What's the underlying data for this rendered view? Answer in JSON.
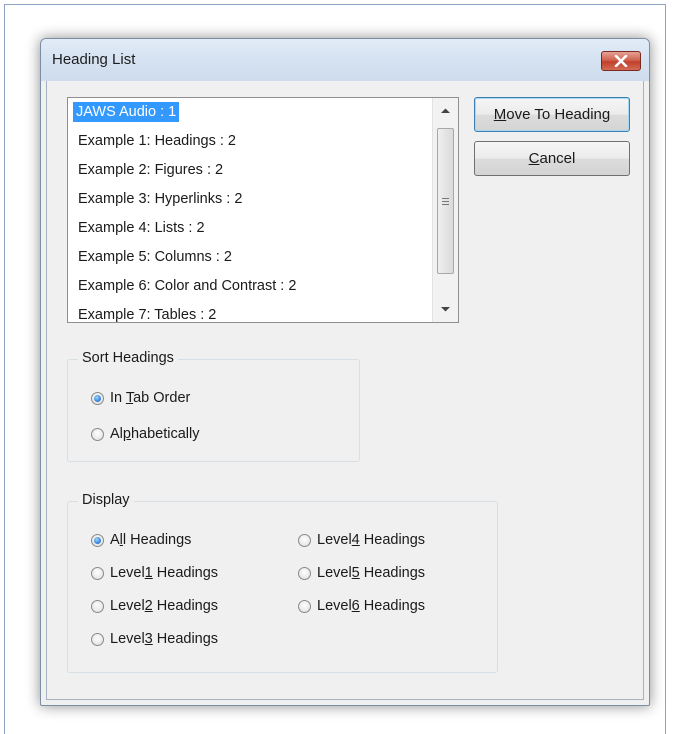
{
  "dialog": {
    "title": "Heading List",
    "close_icon": "close-icon"
  },
  "list": {
    "items": [
      {
        "label": "JAWS Audio : 1",
        "selected": true
      },
      {
        "label": "Example 1: Headings : 2"
      },
      {
        "label": "Example 2: Figures : 2"
      },
      {
        "label": "Example 3: Hyperlinks : 2"
      },
      {
        "label": "Example 4: Lists : 2"
      },
      {
        "label": "Example 5: Columns : 2"
      },
      {
        "label": "Example 6: Color and Contrast : 2"
      },
      {
        "label": "Example 7: Tables : 2"
      }
    ]
  },
  "buttons": {
    "move": {
      "accel": "M",
      "rest": "ove To Heading"
    },
    "cancel": {
      "accel": "C",
      "rest": "ancel"
    }
  },
  "sort": {
    "title": "Sort Headings",
    "tab_order": {
      "pre": "In ",
      "accel": "T",
      "post": "ab Order"
    },
    "alpha": {
      "pre": "Al",
      "accel": "p",
      "post": "habetically"
    }
  },
  "display": {
    "title": "Display",
    "all": {
      "pre": "A",
      "accel": "l",
      "post": "l Headings"
    },
    "level1": {
      "pre": "Level",
      "accel": "1",
      "post": " Headings"
    },
    "level2": {
      "pre": "Level",
      "accel": "2",
      "post": " Headings"
    },
    "level3": {
      "pre": "Level",
      "accel": "3",
      "post": " Headings"
    },
    "level4": {
      "pre": "Level",
      "accel": "4",
      "post": " Headings"
    },
    "level5": {
      "pre": "Level",
      "accel": "5",
      "post": " Headings"
    },
    "level6": {
      "pre": "Level",
      "accel": "6",
      "post": " Headings"
    }
  },
  "colors": {
    "selection": "#3399ff",
    "close_button": "#c0402c",
    "titlebar": "#d5e2f1"
  }
}
